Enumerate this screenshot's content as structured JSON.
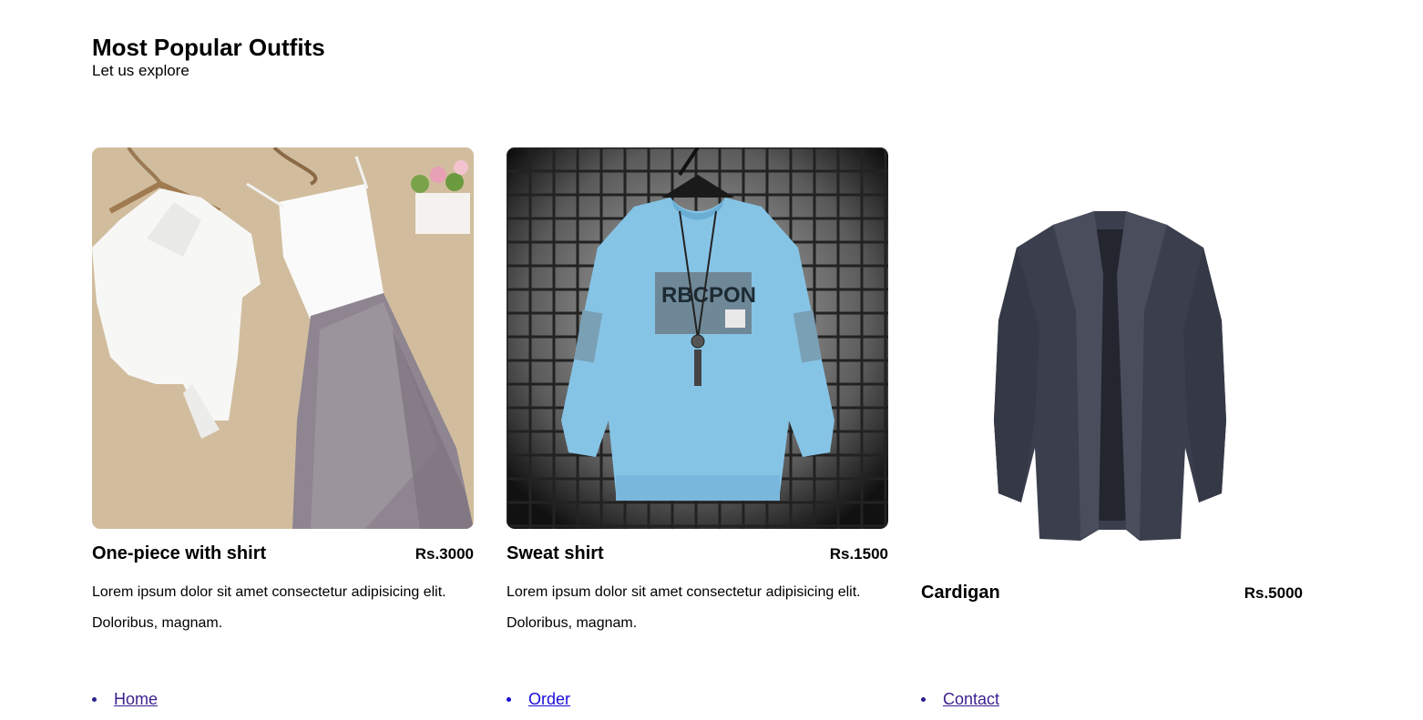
{
  "header": {
    "title": "Most Popular Outfits",
    "subtitle": "Let us explore"
  },
  "products": [
    {
      "name": "One-piece with shirt",
      "price": "Rs.3000",
      "description_line1": "Lorem ipsum dolor sit amet consectetur adipisicing elit.",
      "description_line2": "Doloribus, magnam."
    },
    {
      "name": "Sweat shirt",
      "price": "Rs.1500",
      "description_line1": "Lorem ipsum dolor sit amet consectetur adipisicing elit.",
      "description_line2": "Doloribus, magnam.",
      "image_print_text": "RBCPON"
    },
    {
      "name": "Cardigan",
      "price": "Rs.5000"
    }
  ],
  "nav": [
    {
      "label": "Home"
    },
    {
      "label": "Order"
    },
    {
      "label": "Contact"
    }
  ],
  "colors": {
    "link_visited": "#3b1f8f",
    "link": "#1a0dd8",
    "text": "#000000"
  }
}
